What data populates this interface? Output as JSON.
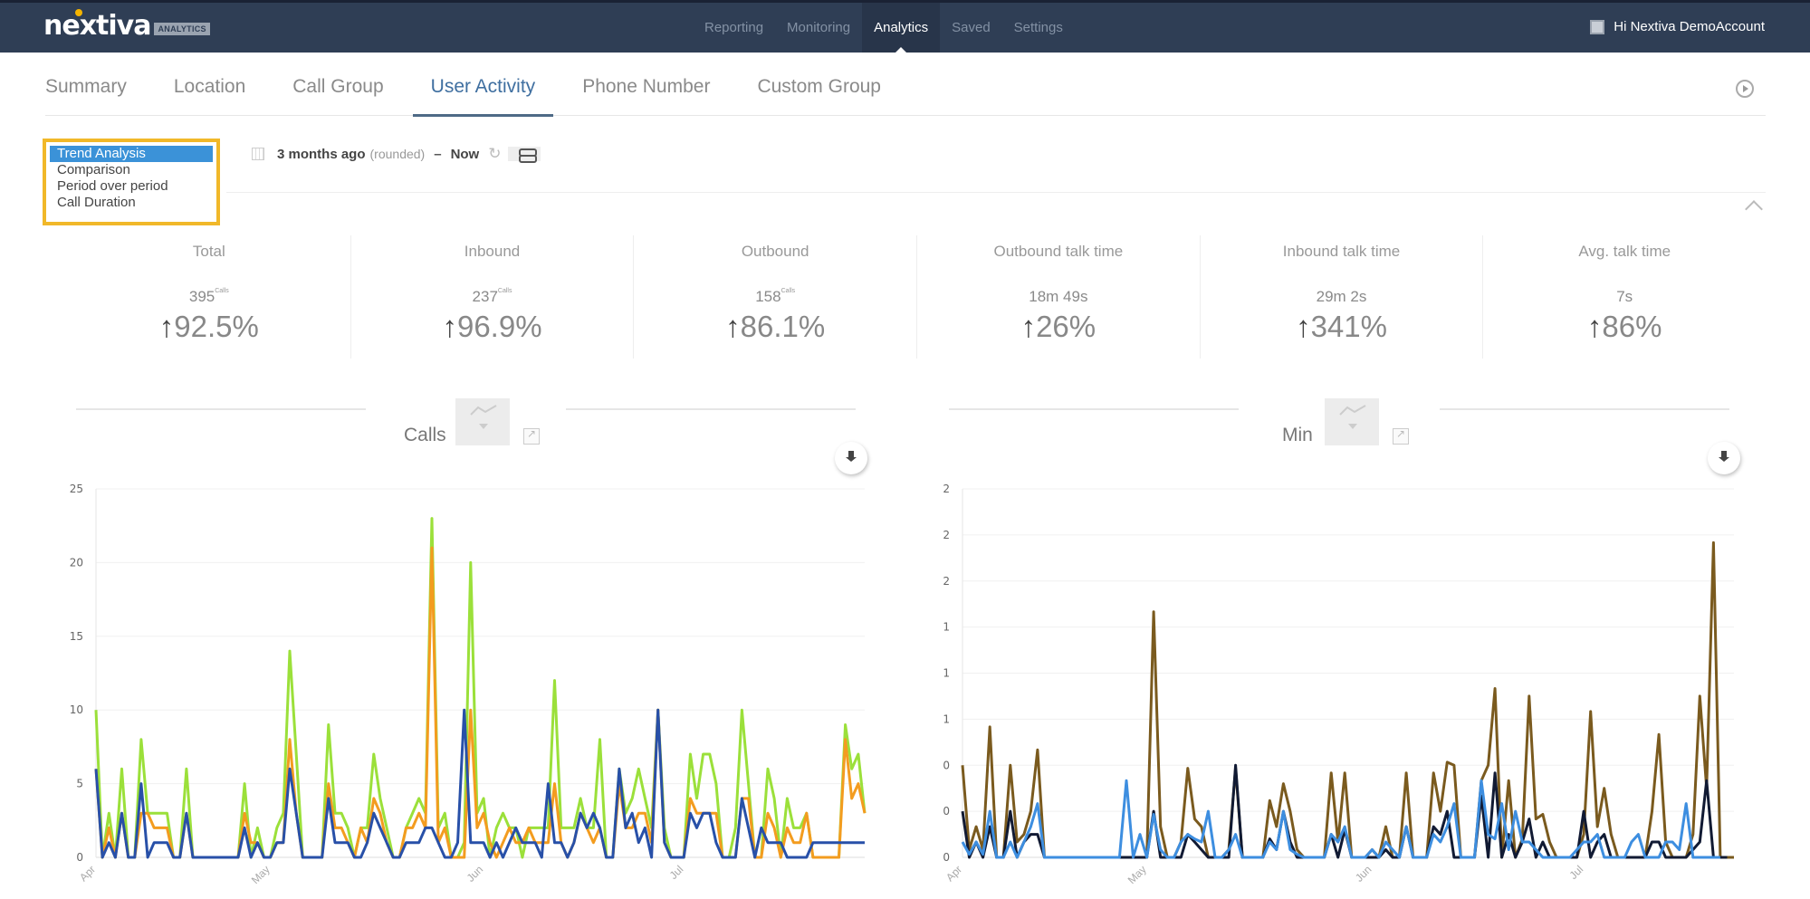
{
  "app": {
    "brand": "nextiva",
    "brand_badge": "ANALYTICS",
    "user_greeting": "Hi Nextiva DemoAccount"
  },
  "nav": [
    {
      "label": "Reporting",
      "active": false
    },
    {
      "label": "Monitoring",
      "active": false
    },
    {
      "label": "Analytics",
      "active": true
    },
    {
      "label": "Saved",
      "active": false
    },
    {
      "label": "Settings",
      "active": false
    }
  ],
  "tabs": [
    {
      "label": "Summary",
      "active": false
    },
    {
      "label": "Location",
      "active": false
    },
    {
      "label": "Call Group",
      "active": false
    },
    {
      "label": "User Activity",
      "active": true
    },
    {
      "label": "Phone Number",
      "active": false
    },
    {
      "label": "Custom Group",
      "active": false
    }
  ],
  "mode_select": {
    "options": [
      "Trend Analysis",
      "Comparison",
      "Period over period",
      "Call Duration"
    ],
    "selected": "Trend Analysis"
  },
  "date_range": {
    "from": "3 months ago",
    "from_note": "(rounded)",
    "separator": "–",
    "to": "Now"
  },
  "kpis": [
    {
      "label": "Total",
      "value": "395",
      "unit": "Calls",
      "arrow": "↑",
      "change": "92.5%"
    },
    {
      "label": "Inbound",
      "value": "237",
      "unit": "Calls",
      "arrow": "↑",
      "change": "96.9%"
    },
    {
      "label": "Outbound",
      "value": "158",
      "unit": "Calls",
      "arrow": "↑",
      "change": "86.1%"
    },
    {
      "label": "Outbound talk time",
      "value": "18m 49s",
      "unit": "",
      "arrow": "↑",
      "change": "26%"
    },
    {
      "label": "Inbound talk time",
      "value": "29m 2s",
      "unit": "",
      "arrow": "↑",
      "change": "341%"
    },
    {
      "label": "Avg. talk time",
      "value": "7s",
      "unit": "",
      "arrow": "↑",
      "change": "86%"
    }
  ],
  "chart_data": [
    {
      "type": "line",
      "title": "Calls",
      "xlabel": "",
      "ylabel": "",
      "ylim": [
        0,
        25
      ],
      "yticks": [
        0,
        5,
        10,
        15,
        20,
        25
      ],
      "ytick_labels": [
        "0",
        "5",
        "10",
        "15",
        "20",
        "25"
      ],
      "xtick_labels": [
        {
          "label": "Apr",
          "index": 0
        },
        {
          "label": "May",
          "index": 27
        },
        {
          "label": "Jun",
          "index": 60
        },
        {
          "label": "Jul",
          "index": 91
        }
      ],
      "grid": true,
      "series": [
        {
          "name": "Total",
          "color": "#9be03a",
          "values": [
            10,
            0,
            3,
            0,
            6,
            0,
            0,
            8,
            3,
            3,
            3,
            3,
            0,
            0,
            6,
            0,
            0,
            0,
            0,
            0,
            0,
            0,
            0,
            5,
            0,
            2,
            0,
            0,
            2,
            3,
            14,
            7,
            0,
            0,
            0,
            0,
            9,
            3,
            3,
            2,
            0,
            2,
            2,
            7,
            4,
            2,
            0,
            0,
            2,
            3,
            4,
            3,
            23,
            2,
            3,
            0,
            0,
            1,
            20,
            3,
            4,
            0,
            2,
            3,
            2,
            2,
            0,
            2,
            2,
            2,
            2,
            12,
            2,
            2,
            2,
            4,
            2,
            2,
            8,
            0,
            0,
            6,
            3,
            4,
            6,
            4,
            2,
            10,
            2,
            0,
            0,
            0,
            7,
            4,
            7,
            7,
            5,
            0,
            0,
            2,
            10,
            5,
            0,
            0,
            6,
            4,
            0,
            4,
            2,
            2,
            3,
            0,
            0,
            0,
            0,
            0,
            9,
            6,
            7,
            3
          ]
        },
        {
          "name": "Inbound",
          "color": "#f39c1f",
          "values": [
            6,
            0,
            2,
            0,
            3,
            0,
            0,
            3,
            3,
            2,
            2,
            2,
            0,
            0,
            3,
            0,
            0,
            0,
            0,
            0,
            0,
            0,
            0,
            3,
            1,
            1,
            0,
            0,
            1,
            1,
            8,
            3,
            0,
            0,
            0,
            0,
            5,
            2,
            2,
            1,
            0,
            2,
            1,
            4,
            3,
            1,
            0,
            0,
            2,
            2,
            3,
            2,
            21,
            1,
            2,
            0,
            0,
            0,
            10,
            2,
            3,
            1,
            0,
            1,
            2,
            1,
            1,
            2,
            1,
            1,
            1,
            5,
            1,
            0,
            1,
            3,
            2,
            1,
            2,
            0,
            0,
            5,
            2,
            2,
            3,
            3,
            1,
            10,
            1,
            0,
            0,
            0,
            4,
            3,
            3,
            3,
            3,
            0,
            0,
            0,
            4,
            4,
            0,
            0,
            3,
            2,
            0,
            2,
            1,
            1,
            3,
            0,
            0,
            0,
            0,
            0,
            8,
            4,
            5,
            3
          ]
        },
        {
          "name": "Outbound",
          "color": "#2850a8",
          "values": [
            6,
            0,
            1,
            0,
            3,
            0,
            0,
            5,
            0,
            1,
            1,
            1,
            0,
            0,
            3,
            0,
            0,
            0,
            0,
            0,
            0,
            0,
            0,
            2,
            0,
            1,
            0,
            0,
            1,
            1,
            6,
            3,
            0,
            0,
            0,
            0,
            4,
            1,
            1,
            1,
            0,
            0,
            1,
            3,
            2,
            1,
            0,
            0,
            1,
            1,
            1,
            2,
            2,
            1,
            0,
            0,
            1,
            10,
            1,
            1,
            1,
            0,
            1,
            0,
            1,
            2,
            1,
            1,
            1,
            0,
            5,
            1,
            1,
            0,
            1,
            3,
            2,
            3,
            2,
            0,
            0,
            6,
            2,
            3,
            1,
            2,
            0,
            10,
            1,
            0,
            0,
            0,
            3,
            2,
            3,
            3,
            1,
            0,
            0,
            0,
            4,
            2,
            0,
            2,
            1,
            1,
            1,
            0,
            0,
            0,
            0,
            1,
            1,
            1,
            1,
            1,
            1,
            1,
            1,
            1
          ]
        }
      ]
    },
    {
      "type": "line",
      "title": "Min",
      "xlabel": "",
      "ylabel": "",
      "ylim": [
        0,
        2.4
      ],
      "yticks": [
        0,
        0.3,
        0.6,
        0.9,
        1.2,
        1.5,
        1.8,
        2.1,
        2.4
      ],
      "ytick_labels": [
        "0",
        "0",
        "0",
        "1",
        "1",
        "1",
        "2",
        "2",
        "2"
      ],
      "xtick_labels": [
        {
          "label": "Apr",
          "index": 0
        },
        {
          "label": "May",
          "index": 27
        },
        {
          "label": "Jun",
          "index": 60
        },
        {
          "label": "Jul",
          "index": 91
        }
      ],
      "grid": true,
      "series": [
        {
          "name": "Outbound talk time",
          "color": "#7a5a1e",
          "values": [
            0.6,
            0.05,
            0.2,
            0.05,
            0.85,
            0,
            0,
            0.6,
            0.1,
            0.15,
            0.3,
            0.7,
            0,
            0,
            0,
            0,
            0,
            0,
            0,
            0,
            0,
            0,
            0,
            0,
            0,
            0,
            0,
            0,
            1.6,
            0.2,
            0,
            0,
            0.1,
            0.58,
            0.25,
            0.2,
            0,
            0,
            0,
            0.05,
            0.58,
            0,
            0,
            0,
            0,
            0.37,
            0.2,
            0.48,
            0.3,
            0.05,
            0,
            0,
            0,
            0,
            0.55,
            0.1,
            0.55,
            0,
            0,
            0,
            0.05,
            0,
            0.2,
            0,
            0,
            0.55,
            0,
            0,
            0,
            0.55,
            0.3,
            0.62,
            0.6,
            0,
            0,
            0,
            0.5,
            0.6,
            1.1,
            0,
            0.5,
            0,
            0.12,
            1.05,
            0.25,
            0.28,
            0.1,
            0,
            0,
            0,
            0,
            0.15,
            0.95,
            0.2,
            0.45,
            0.15,
            0,
            0,
            0,
            0,
            0,
            0.3,
            0.8,
            0.1,
            0,
            0,
            0,
            0.15,
            1.05,
            0.45,
            2.05,
            0,
            0,
            0
          ]
        },
        {
          "name": "Inbound talk time",
          "color": "#111a33",
          "values": [
            0.3,
            0,
            0.1,
            0,
            0.2,
            0,
            0,
            0.3,
            0,
            0.1,
            0.15,
            0.15,
            0,
            0,
            0,
            0,
            0,
            0,
            0,
            0,
            0,
            0,
            0,
            0,
            0,
            0,
            0,
            0,
            0.3,
            0,
            0,
            0,
            0,
            0.15,
            0.1,
            0.05,
            0,
            0,
            0,
            0,
            0.6,
            0,
            0,
            0,
            0,
            0.12,
            0.05,
            0.3,
            0.1,
            0,
            0,
            0,
            0,
            0,
            0.15,
            0,
            0.18,
            0,
            0,
            0,
            0,
            0,
            0.05,
            0,
            0,
            0.2,
            0,
            0,
            0,
            0.2,
            0.15,
            0.3,
            0,
            0,
            0,
            0,
            0.4,
            0,
            0.55,
            0,
            0.15,
            0,
            0.1,
            0.25,
            0,
            0.1,
            0,
            0,
            0,
            0,
            0,
            0.3,
            0,
            0.1,
            0.15,
            0,
            0,
            0,
            0,
            0,
            0,
            0.1,
            0.1,
            0,
            0,
            0,
            0,
            0.05,
            0.1,
            0.5,
            0,
            0,
            0
          ]
        },
        {
          "name": "Avg. talk time",
          "color": "#3d8ee0",
          "values": [
            0.1,
            0.02,
            0.1,
            0.02,
            0.3,
            0,
            0,
            0.1,
            0,
            0.1,
            0.2,
            0.35,
            0,
            0,
            0,
            0,
            0,
            0,
            0,
            0,
            0,
            0,
            0,
            0,
            0.5,
            0,
            0.15,
            0,
            0.28,
            0.05,
            0,
            0,
            0.1,
            0.15,
            0.12,
            0.1,
            0.3,
            0,
            0,
            0.05,
            0.15,
            0,
            0,
            0,
            0,
            0.1,
            0.05,
            0.3,
            0.05,
            0.02,
            0,
            0,
            0,
            0,
            0.15,
            0.1,
            0.2,
            0,
            0,
            0,
            0.05,
            0,
            0.1,
            0.05,
            0,
            0.2,
            0,
            0,
            0,
            0.15,
            0.1,
            0.2,
            0.35,
            0,
            0,
            0,
            0.5,
            0.15,
            0.12,
            0.35,
            0.05,
            0.3,
            0.1,
            0.1,
            0.05,
            0,
            0,
            0,
            0,
            0,
            0.05,
            0.1,
            0.1,
            0.15,
            0,
            0,
            0,
            0,
            0.1,
            0.15,
            0,
            0,
            0,
            0.1,
            0.1,
            0.05,
            0.35,
            0,
            0,
            0,
            0,
            0
          ]
        }
      ]
    }
  ]
}
